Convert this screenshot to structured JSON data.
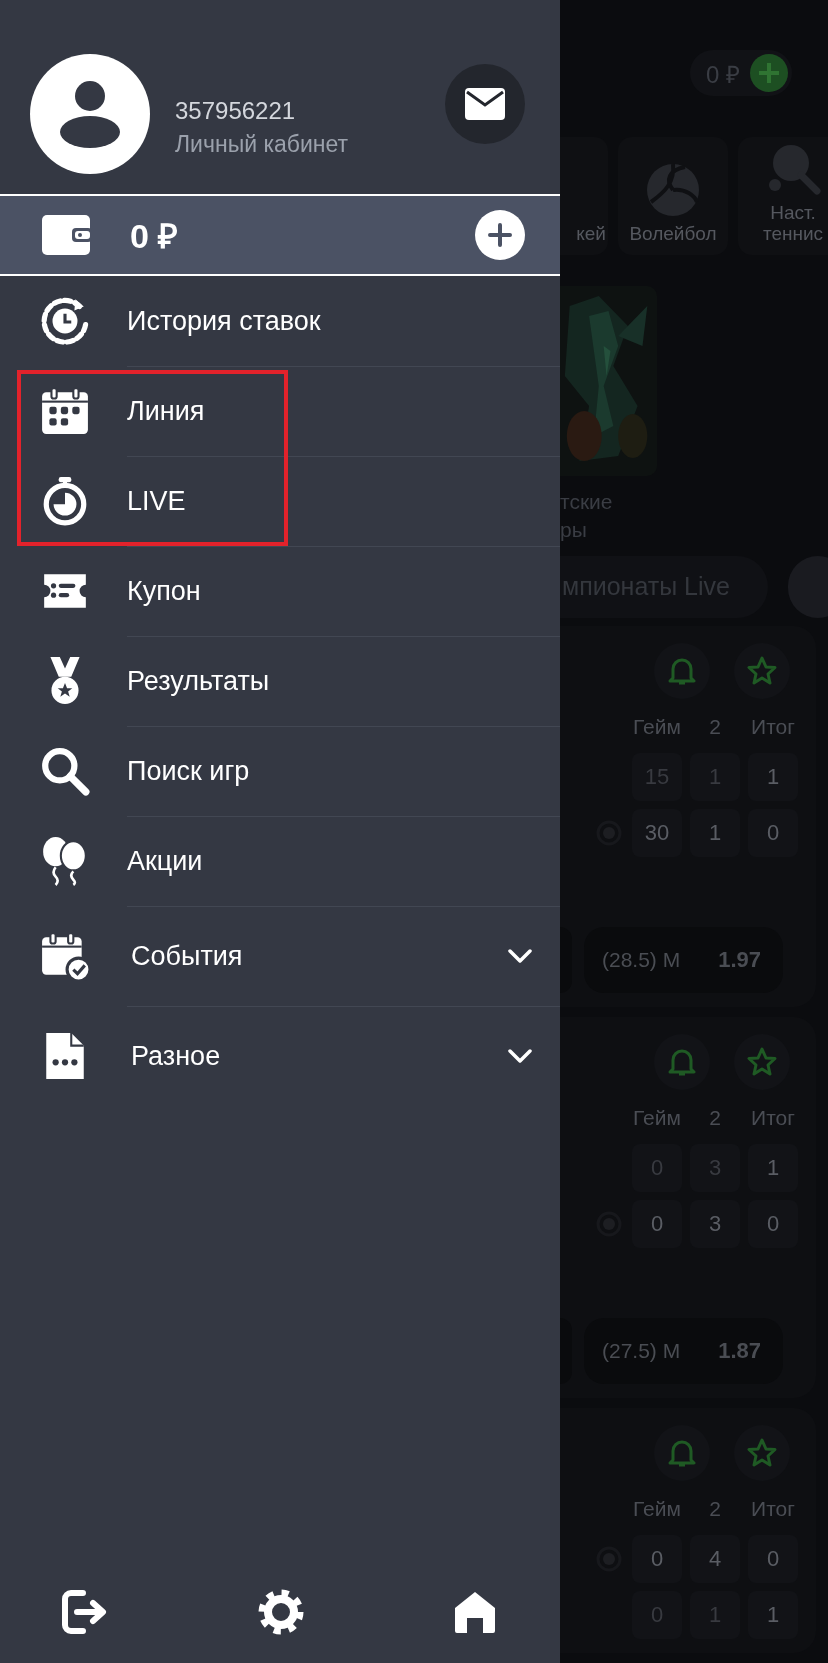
{
  "profile": {
    "account_id": "357956221",
    "subtitle": "Личный кабинет"
  },
  "wallet": {
    "balance": "0 ₽"
  },
  "menu": [
    {
      "label": "История ставок",
      "kind": "link",
      "highlighted": false
    },
    {
      "label": "Линия",
      "kind": "link",
      "highlighted": true
    },
    {
      "label": "LIVE",
      "kind": "link",
      "highlighted": true
    },
    {
      "label": "Купон",
      "kind": "link",
      "highlighted": false
    },
    {
      "label": "Результаты",
      "kind": "link",
      "highlighted": false
    },
    {
      "label": "Поиск игр",
      "kind": "link",
      "highlighted": false
    },
    {
      "label": "Акции",
      "kind": "link",
      "highlighted": false
    },
    {
      "label": "События",
      "kind": "group",
      "expanded": false,
      "highlighted": false
    },
    {
      "label": "Разное",
      "kind": "group",
      "expanded": false,
      "highlighted": false
    }
  ],
  "background": {
    "balance": "0 ₽",
    "sports": [
      {
        "label": "кей"
      },
      {
        "label": "Волейбол"
      },
      {
        "label": "Наст. теннис"
      }
    ],
    "promo_caption": [
      "тские",
      "ры"
    ],
    "filters": [
      "мпионаты Live"
    ],
    "matches": [
      {
        "columns": [
          "Гейм",
          "2",
          "Итог"
        ],
        "rows": [
          {
            "serving": false,
            "cells": [
              {
                "value": "15",
                "dim": true
              },
              {
                "value": "1",
                "dim": true
              },
              {
                "value": "1",
                "dim": false
              }
            ]
          },
          {
            "serving": true,
            "cells": [
              {
                "value": "30",
                "dim": false
              },
              {
                "value": "1",
                "dim": false
              },
              {
                "value": "0",
                "dim": false
              }
            ]
          }
        ],
        "bet": {
          "line": "(28.5) M",
          "odds": "1.97"
        }
      },
      {
        "columns": [
          "Гейм",
          "2",
          "Итог"
        ],
        "rows": [
          {
            "serving": false,
            "cells": [
              {
                "value": "0",
                "dim": true
              },
              {
                "value": "3",
                "dim": true
              },
              {
                "value": "1",
                "dim": false
              }
            ]
          },
          {
            "serving": true,
            "cells": [
              {
                "value": "0",
                "dim": false
              },
              {
                "value": "3",
                "dim": false
              },
              {
                "value": "0",
                "dim": false
              }
            ]
          }
        ],
        "bet": {
          "line": "(27.5) M",
          "odds": "1.87"
        }
      },
      {
        "columns": [
          "Гейм",
          "2",
          "Итог"
        ],
        "rows": [
          {
            "serving": true,
            "cells": [
              {
                "value": "0",
                "dim": false
              },
              {
                "value": "4",
                "dim": false
              },
              {
                "value": "0",
                "dim": false
              }
            ]
          },
          {
            "serving": false,
            "cells": [
              {
                "value": "0",
                "dim": true
              },
              {
                "value": "1",
                "dim": true
              },
              {
                "value": "1",
                "dim": false
              }
            ]
          }
        ]
      }
    ]
  }
}
